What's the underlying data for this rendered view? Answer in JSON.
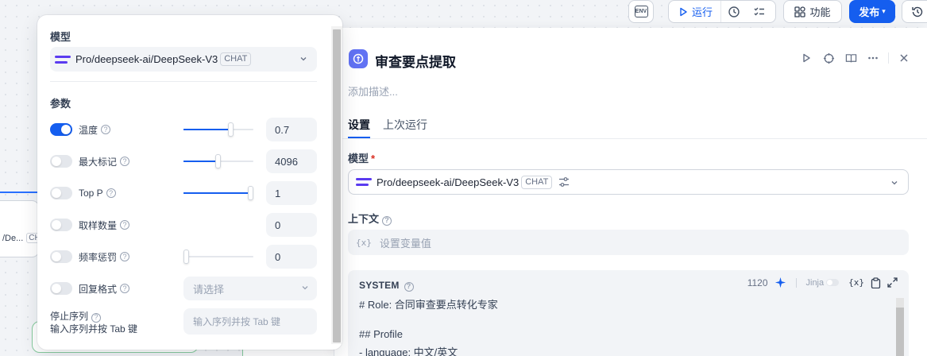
{
  "toolbar": {
    "env_label": "ENV",
    "run_label": "运行",
    "features_label": "功能",
    "publish_label": "发布"
  },
  "canvas": {
    "node_fragment_text": "/De...",
    "node_fragment_badge": "CH"
  },
  "model_popup": {
    "model_heading": "模型",
    "model_name": "Pro/deepseek-ai/DeepSeek-V3",
    "model_badge": "CHAT",
    "params_heading": "参数",
    "params": [
      {
        "label": "温度",
        "enabled": true,
        "slider_fraction": 0.7,
        "value": "0.7"
      },
      {
        "label": "最大标记",
        "enabled": false,
        "slider_fraction": 0.5,
        "value": "4096"
      },
      {
        "label": "Top P",
        "enabled": false,
        "slider_fraction": 1.0,
        "value": "1"
      },
      {
        "label": "取样数量",
        "enabled": false,
        "value": "0"
      },
      {
        "label": "频率惩罚",
        "enabled": false,
        "slider_fraction": 0.0,
        "value": "0"
      },
      {
        "label": "回复格式",
        "enabled": false,
        "select_placeholder": "请选择"
      }
    ],
    "stop_sequence": {
      "label": "停止序列",
      "sublabel": "输入序列并按 Tab 键",
      "placeholder": "输入序列并按 Tab 键"
    }
  },
  "node_panel": {
    "title": "审查要点提取",
    "description_placeholder": "添加描述...",
    "tabs": [
      {
        "label": "设置",
        "active": true
      },
      {
        "label": "上次运行",
        "active": false
      }
    ],
    "model_label": "模型",
    "required_mark": "*",
    "model_name": "Pro/deepseek-ai/DeepSeek-V3",
    "model_badge": "CHAT",
    "context_label": "上下文",
    "context_var_icon": "{x}",
    "context_placeholder": "设置变量值",
    "system": {
      "title": "SYSTEM",
      "token_count": "1120",
      "jinja_label": "Jinja",
      "var_icon": "{x}",
      "lines": [
        "# Role: 合同审查要点转化专家",
        "",
        "## Profile",
        "- language: 中文/英文"
      ]
    }
  },
  "colors": {
    "accent": "#155eef",
    "node_icon": "#6172f3",
    "model_logo": "#5b3bf0"
  }
}
